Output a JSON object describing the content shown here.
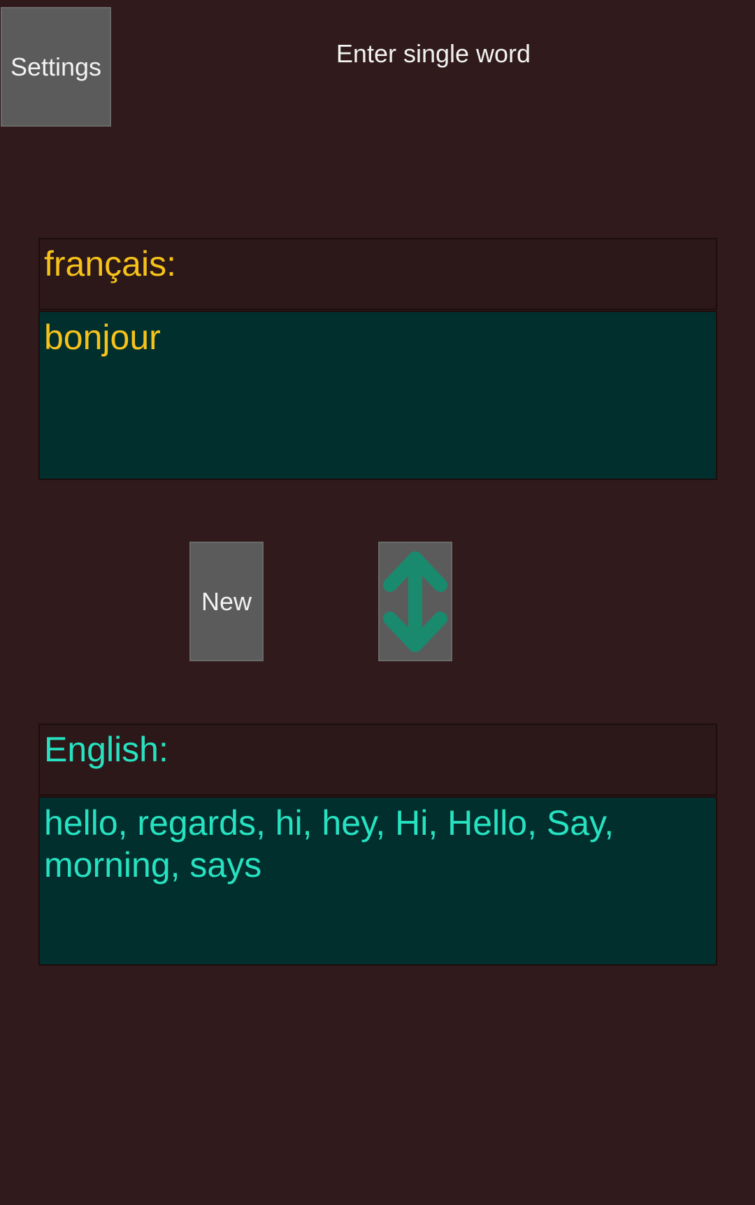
{
  "toolbar": {
    "settings_label": "Settings",
    "hint": "Enter single word"
  },
  "source": {
    "label": "français:",
    "text": "bonjour",
    "color": "#f5c21a"
  },
  "controls": {
    "new_label": "New",
    "swap_icon": "up-down-arrow-icon",
    "swap_color": "#1a8a6e"
  },
  "target": {
    "label": "English:",
    "text": "hello, regards, hi, hey, Hi, Hello, Say, morning, says",
    "color": "#27e2c0"
  },
  "colors": {
    "background": "#301a1b",
    "field_background": "#012f2e",
    "button_background": "#5b5b5b"
  }
}
